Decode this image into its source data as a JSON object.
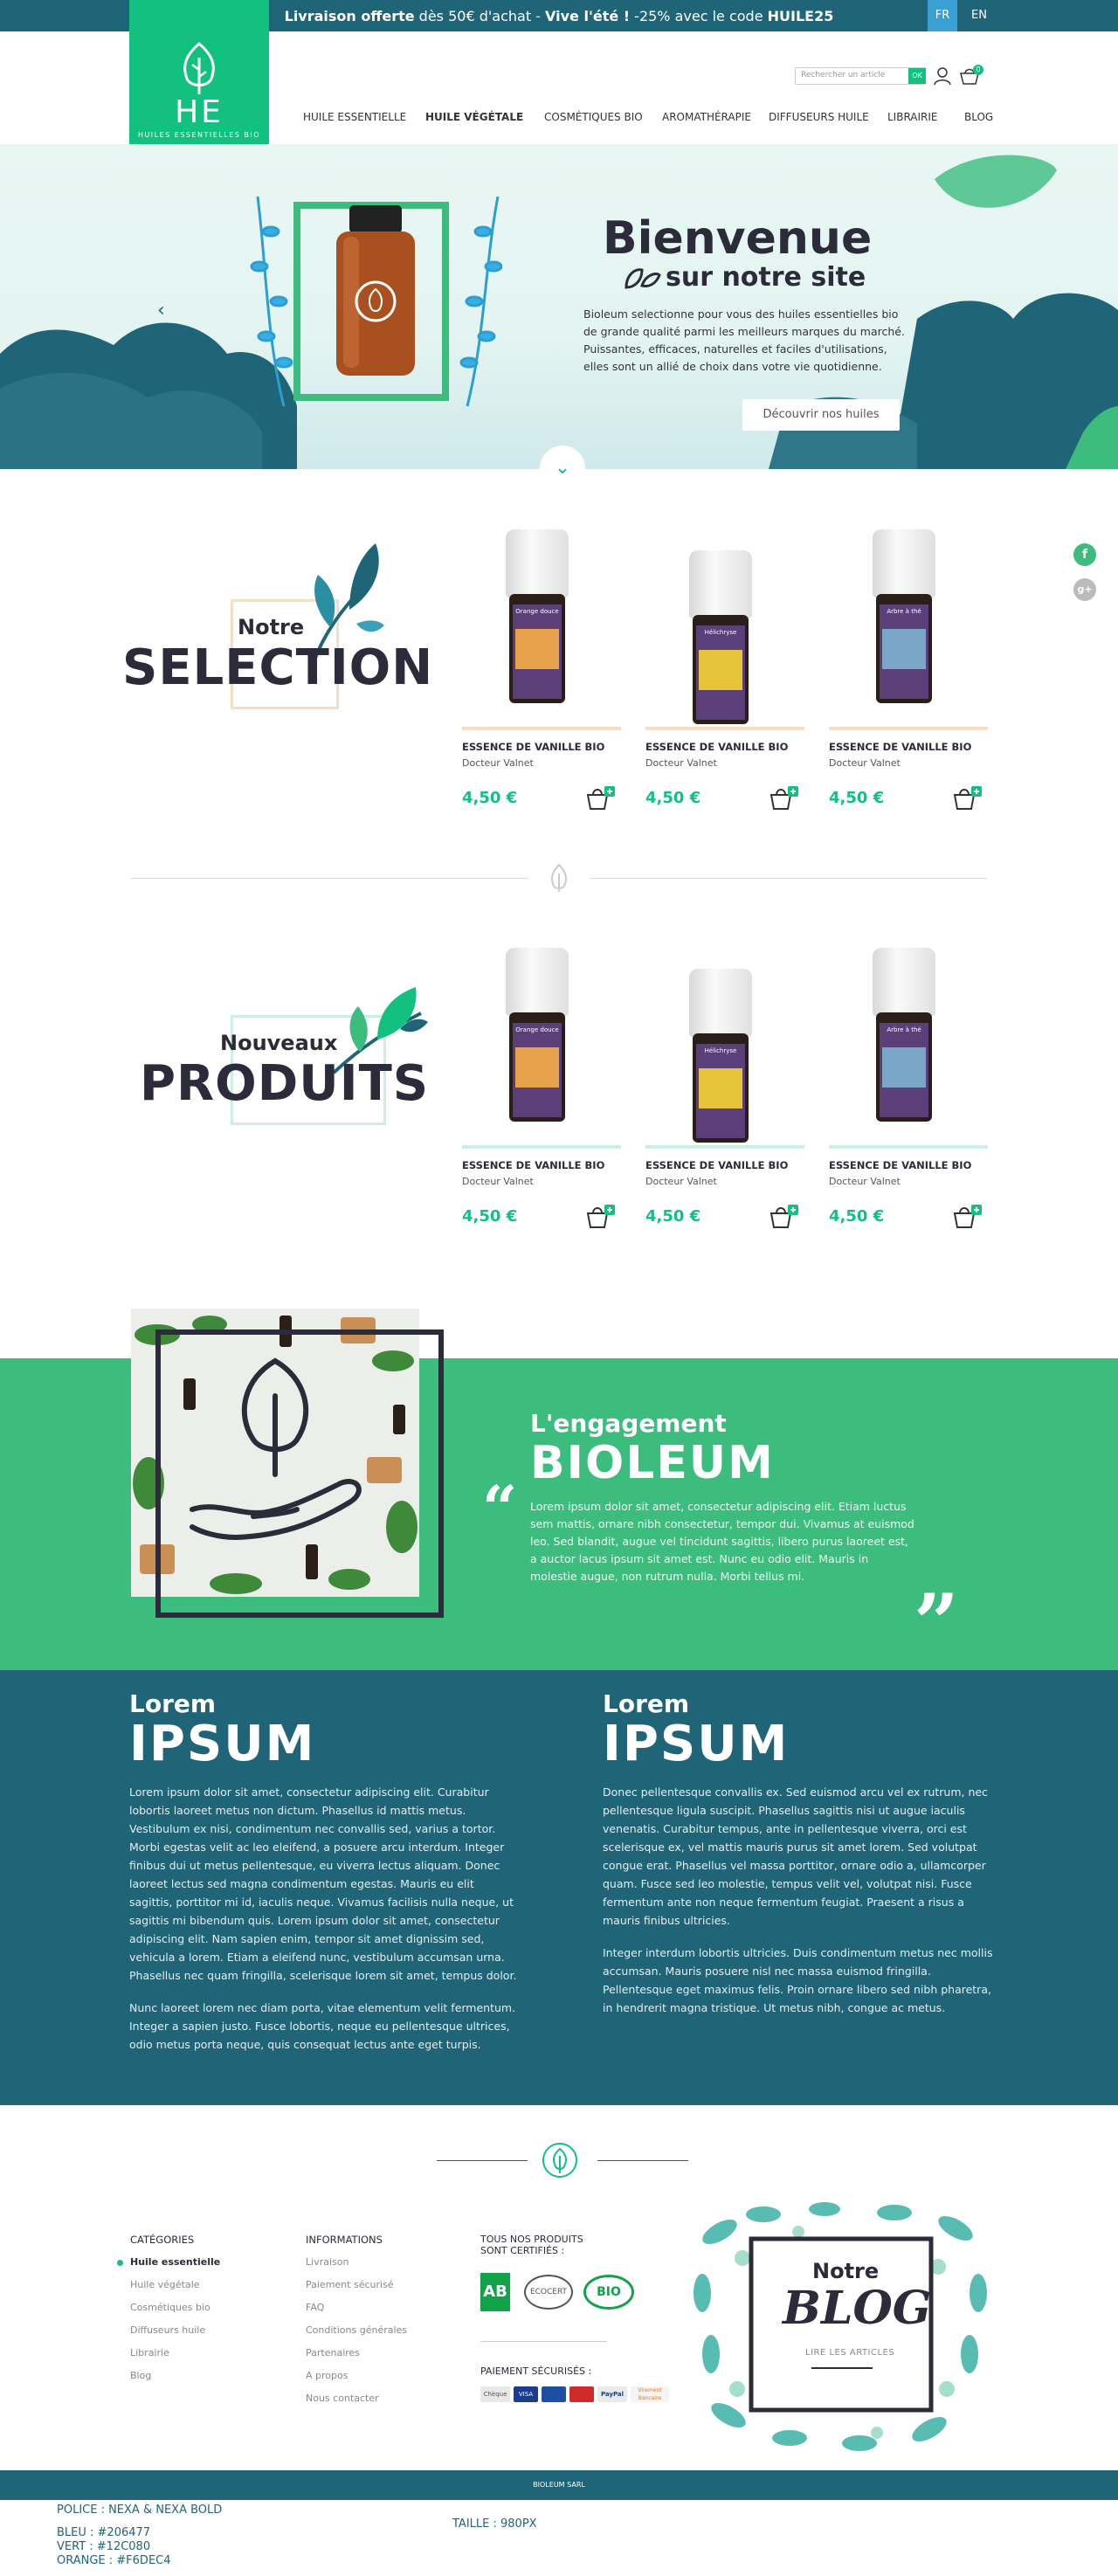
{
  "topbar": {
    "promo_part1_bold": "Livraison offerte",
    "promo_part1_rest": " dès 50€ d'achat  -  ",
    "promo_part2_bold": "Vive l'été !",
    "promo_part2_rest": " -25% avec le code ",
    "promo_code": "HUILE25",
    "lang_fr": "FR",
    "lang_en": "EN"
  },
  "logo": {
    "mark": "HE",
    "subtitle": "HUILES ESSENTIELLES BIO"
  },
  "header": {
    "search_placeholder": "Rechercher un article",
    "search_button": "OK",
    "cart_count": "0"
  },
  "nav": [
    "HUILE ESSENTIELLE",
    "HUILE VÉGÉTALE",
    "COSMÉTIQUES BIO",
    "AROMATHÉRAPIE",
    "DIFFUSEURS HUILE",
    "LIBRAIRIE",
    "BLOG"
  ],
  "hero": {
    "title": "Bienvenue",
    "subtitle": "sur notre site",
    "text": "Bioleum selectionne pour vous des huiles essentielles bio de grande qualité parmi les meilleurs marques du marché. Puissantes, efficaces, naturelles et faciles d'utilisations, elles sont un allié de choix dans votre vie quotidienne.",
    "cta": "Découvrir nos huiles"
  },
  "selection": {
    "small": "Notre",
    "big": "SELECTION",
    "products": [
      {
        "name": "ESSENCE DE VANILLE BIO",
        "brand": "Docteur Valnet",
        "price": "4,50 €",
        "label": "Orange douce",
        "color": "#e8a24a"
      },
      {
        "name": "ESSENCE DE VANILLE BIO",
        "brand": "Docteur Valnet",
        "price": "4,50 €",
        "label": "Hélichryse",
        "color": "#e6c53a"
      },
      {
        "name": "ESSENCE DE VANILLE BIO",
        "brand": "Docteur Valnet",
        "price": "4,50 €",
        "label": "Arbre à thé",
        "color": "#7aa7c7"
      }
    ]
  },
  "nouveaux": {
    "small": "Nouveaux",
    "big": "PRODUITS",
    "products": [
      {
        "name": "ESSENCE DE VANILLE BIO",
        "brand": "Docteur Valnet",
        "price": "4,50 €",
        "label": "Orange douce",
        "color": "#e8a24a"
      },
      {
        "name": "ESSENCE DE VANILLE BIO",
        "brand": "Docteur Valnet",
        "price": "4,50 €",
        "label": "Hélichryse",
        "color": "#e6c53a"
      },
      {
        "name": "ESSENCE DE VANILLE BIO",
        "brand": "Docteur Valnet",
        "price": "4,50 €",
        "label": "Arbre à thé",
        "color": "#7aa7c7"
      }
    ]
  },
  "engagement": {
    "small": "L'engagement",
    "big": "BIOLEUM",
    "text": "Lorem ipsum dolor sit amet, consectetur adipiscing elit. Etiam luctus sem mattis, ornare nibh consectetur, tempor dui. Vivamus at euismod leo. Sed blandit, augue vel tincidunt sagittis, libero purus laoreet est, a auctor lacus ipsum sit amet est. Nunc eu odio elit. Mauris in molestie augue, non rutrum nulla. Morbi tellus mi."
  },
  "ipsum": {
    "left": {
      "small": "Lorem",
      "big": "IPSUM",
      "p1": "Lorem ipsum dolor sit amet, consectetur adipiscing elit. Curabitur lobortis laoreet metus non dictum. Phasellus id mattis metus. Vestibulum ex nisi, condimentum nec convallis sed, varius a tortor. Morbi egestas velit ac leo eleifend, a posuere arcu interdum. Integer finibus dui ut metus pellentesque, eu viverra lectus aliquam. Donec laoreet lectus sed magna condimentum egestas. Mauris eu elit sagittis, porttitor mi id, iaculis neque. Vivamus facilisis nulla neque, ut sagittis mi bibendum quis. Lorem ipsum dolor sit amet, consectetur adipiscing elit. Nam sapien enim, tempor sit amet dignissim sed, vehicula a lorem. Etiam a eleifend nunc, vestibulum accumsan urna. Phasellus nec quam fringilla, scelerisque lorem sit amet, tempus dolor.",
      "p2": "Nunc laoreet lorem nec diam porta, vitae elementum velit fermentum. Integer a sapien justo. Fusce lobortis, neque eu pellentesque ultrices, odio metus porta neque, quis consequat lectus ante eget turpis."
    },
    "right": {
      "small": "Lorem",
      "big": "IPSUM",
      "p1": "Donec pellentesque convallis ex. Sed euismod arcu vel ex rutrum, nec pellentesque ligula suscipit. Phasellus sagittis nisi ut augue iaculis venenatis. Curabitur tempus, ante in pellentesque viverra, orci est scelerisque ex, vel mattis mauris purus sit amet lorem. Sed volutpat congue erat. Phasellus vel massa porttitor, ornare odio a, ullamcorper quam. Fusce sed leo molestie, tempus velit vel, volutpat nisi. Fusce fermentum ante non neque fermentum feugiat. Praesent a risus a mauris finibus ultricies.",
      "p2": "Integer interdum lobortis ultricies. Duis condimentum metus nec mollis accumsan. Mauris posuere nisl nec massa euismod fringilla. Pellentesque eget maximus felis. Proin ornare libero sed nibh pharetra, in hendrerit magna tristique. Ut metus nibh, congue ac metus."
    }
  },
  "footer": {
    "categories_title": "CATÉGORIES",
    "categories": [
      "Huile essentielle",
      "Huile végétale",
      "Cosmétiques bio",
      "Diffuseurs huile",
      "Librairie",
      "Blog"
    ],
    "info_title": "INFORMATIONS",
    "info": [
      "Livraison",
      "Paiement sécurisé",
      "FAQ",
      "Conditions générales",
      "Partenaires",
      "A propos",
      "Nous contacter"
    ],
    "certified_title_1": "TOUS NOS PRODUITS",
    "certified_title_2": "SONT CERTIFIÉS :",
    "cert_ab": "AB",
    "cert_ecocert": "ECOCERT",
    "cert_bio": "BIO",
    "payment_title": "PAIEMENT SÉCURISÉS :",
    "payments": [
      "Chèque",
      "VISA",
      "",
      "",
      "PayPal",
      "Virement Bancaire"
    ],
    "blog_small": "Notre",
    "blog_big": "BLOG",
    "blog_link": "LIRE LES ARTICLES"
  },
  "bottom_bar": "BIOLEUM SARL",
  "specs": {
    "font": "POLICE : NEXA & NEXA BOLD",
    "blue": "BLEU : #206477",
    "green": "VERT : #12C080",
    "orange": "ORANGE : #F6DEC4",
    "size": "TAILLE : 980PX"
  },
  "colors": {
    "blue": "#206477",
    "green": "#12C080",
    "orange": "#F6DEC4"
  }
}
